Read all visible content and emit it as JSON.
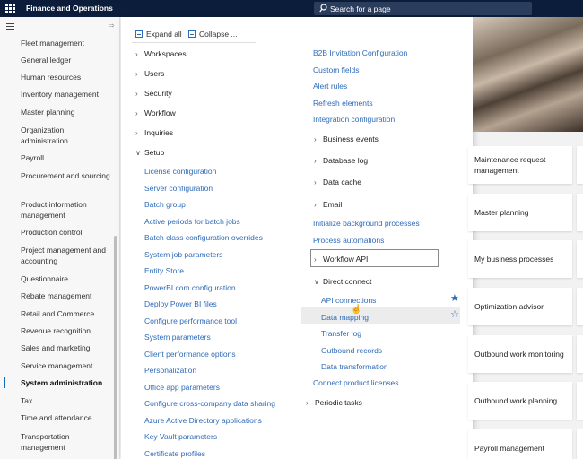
{
  "app": {
    "name": "Finance and Operations"
  },
  "search": {
    "placeholder": "Search for a page"
  },
  "nav": {
    "items": [
      "Fleet management",
      "General ledger",
      "Human resources",
      "Inventory management",
      "Master planning",
      "Organization administration",
      "Payroll",
      "Procurement and sourcing",
      "Product information management",
      "Production control",
      "Project management and accounting",
      "Questionnaire",
      "Rebate management",
      "Retail and Commerce",
      "Revenue recognition",
      "Sales and marketing",
      "Service management",
      "System administration",
      "Tax",
      "Time and attendance",
      "Transportation management"
    ],
    "active": "System administration"
  },
  "flyout": {
    "toolbar": {
      "expand_all": "Expand all",
      "collapse": "Collapse ..."
    },
    "col1_groups": [
      "Workspaces",
      "Users",
      "Security",
      "Workflow",
      "Inquiries",
      "Setup"
    ],
    "setup_links": [
      "License configuration",
      "Server configuration",
      "Batch group",
      "Active periods for batch jobs",
      "Batch class configuration overrides",
      "System job parameters",
      "Entity Store",
      "PowerBI.com configuration",
      "Deploy Power BI files",
      "Configure performance tool",
      "System parameters",
      "Client performance options",
      "Personalization",
      "Office app parameters",
      "Configure cross-company data sharing",
      "Azure Active Directory applications",
      "Key Vault parameters",
      "Certificate profiles"
    ],
    "col2_links_top": [
      "B2B Invitation Configuration",
      "Custom fields",
      "Alert rules",
      "Refresh elements",
      "Integration configuration"
    ],
    "col2_groups_a": [
      "Business events",
      "Database log",
      "Data cache",
      "Email"
    ],
    "col2_links_mid": [
      "Initialize background processes",
      "Process automations"
    ],
    "workflow_api": "Workflow API",
    "direct_connect": "Direct connect",
    "direct_connect_links": [
      "API connections",
      "Data mapping",
      "Transfer log",
      "Outbound records",
      "Data transformation"
    ],
    "connect_licenses": "Connect product licenses",
    "periodic_tasks": "Periodic tasks"
  },
  "tiles": [
    "Maintenance request management",
    "Master planning",
    "My business processes",
    "Optimization advisor",
    "Outbound work monitoring",
    "Outbound work planning",
    "Payroll management"
  ],
  "colors": {
    "topbar": "#0b1d3a",
    "link": "#2f6bb8",
    "accent": "#0f6cbd"
  }
}
